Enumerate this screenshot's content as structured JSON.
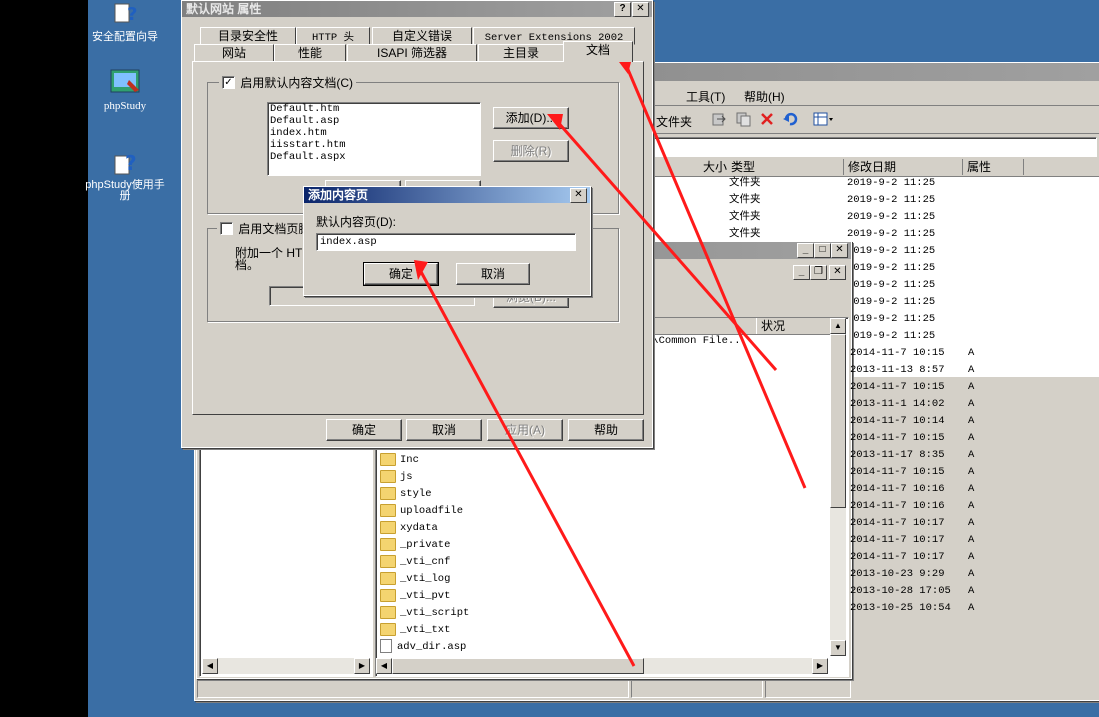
{
  "desktop": {
    "icons": [
      {
        "label": "安全配置向导",
        "icon": "security-wizard-icon"
      },
      {
        "label": "phpStudy",
        "icon": "phpstudy-icon"
      },
      {
        "label": "phpStudy使用手册",
        "icon": "help-manual-icon"
      }
    ]
  },
  "explorer": {
    "menu": {
      "tools": "工具(T)",
      "help": "帮助(H)"
    },
    "toolbar": {
      "folders": "文件夹"
    },
    "columns": {
      "size": "大小",
      "type": "类型",
      "modified": "修改日期",
      "attributes": "属性"
    },
    "top_rows": [
      {
        "type": "文件夹",
        "date": "2019-9-2 11:25"
      },
      {
        "type": "文件夹",
        "date": "2019-9-2 11:25"
      },
      {
        "type": "文件夹",
        "date": "2019-9-2 11:25"
      },
      {
        "type": "文件夹",
        "date": "2019-9-2 11:25"
      }
    ],
    "date_rows_partial": [
      "2019-9-2 11:25",
      "2019-9-2 11:25",
      "2019-9-2 11:25",
      "2019-9-2 11:25",
      "2019-9-2 11:25",
      "2019-9-2 11:25"
    ]
  },
  "inner_window": {
    "status_col": "状况",
    "path_fragment": "s\\Common File...",
    "files": [
      {
        "name": "Inc",
        "kind": "folder"
      },
      {
        "name": "js",
        "kind": "folder"
      },
      {
        "name": "style",
        "kind": "folder"
      },
      {
        "name": "uploadfile",
        "kind": "folder"
      },
      {
        "name": "xydata",
        "kind": "folder"
      },
      {
        "name": "_private",
        "kind": "folder"
      },
      {
        "name": "_vti_cnf",
        "kind": "folder"
      },
      {
        "name": "_vti_log",
        "kind": "folder"
      },
      {
        "name": "_vti_pvt",
        "kind": "folder"
      },
      {
        "name": "_vti_script",
        "kind": "folder"
      },
      {
        "name": "_vti_txt",
        "kind": "folder"
      },
      {
        "name": "adv_dir.asp",
        "kind": "file"
      }
    ],
    "date_rows": [
      {
        "date": "2014-11-7 10:15",
        "attr": "A"
      },
      {
        "date": "2013-11-13 8:57",
        "attr": "A"
      },
      {
        "date": "2014-11-7 10:15",
        "attr": "A"
      },
      {
        "date": "2013-11-1 14:02",
        "attr": "A"
      },
      {
        "date": "2014-11-7 10:14",
        "attr": "A"
      },
      {
        "date": "2014-11-7 10:15",
        "attr": "A"
      },
      {
        "date": "2013-11-17 8:35",
        "attr": "A"
      },
      {
        "date": "2014-11-7 10:15",
        "attr": "A"
      },
      {
        "date": "2014-11-7 10:16",
        "attr": "A"
      },
      {
        "date": "2014-11-7 10:16",
        "attr": "A"
      },
      {
        "date": "2014-11-7 10:17",
        "attr": "A"
      },
      {
        "date": "2014-11-7 10:17",
        "attr": "A"
      },
      {
        "date": "2014-11-7 10:17",
        "attr": "A"
      },
      {
        "date": "2013-10-23 9:29",
        "attr": "A"
      },
      {
        "date": "2013-10-28 17:05",
        "attr": "A"
      },
      {
        "date": "2013-10-25 10:54",
        "attr": "A"
      }
    ]
  },
  "props_dialog": {
    "title": "默认网站 属性",
    "help_glyph": "?",
    "close_glyph": "✕",
    "tabs_row1": [
      "目录安全性",
      "HTTP 头",
      "自定义错误",
      "Server Extensions 2002"
    ],
    "tabs_row2": [
      "网站",
      "性能",
      "ISAPI 筛选器",
      "主目录",
      "文档"
    ],
    "enable_default_doc": "启用默认内容文档(C)",
    "default_docs": [
      "Default.htm",
      "Default.asp",
      "index.htm",
      "iisstart.htm",
      "Default.aspx"
    ],
    "add_button": "添加(D)...",
    "remove_button": "删除(R)",
    "enable_footer": "启用文档页脚",
    "footer_desc_line1": "附加一个 HTM",
    "footer_desc_line2": "档。",
    "browse_button": "浏览(B)...",
    "ok": "确定",
    "cancel": "取消",
    "apply": "应用(A)",
    "help": "帮助"
  },
  "add_dialog": {
    "title": "添加内容页",
    "close_glyph": "✕",
    "label": "默认内容页(D):",
    "value": "index.asp",
    "ok": "确定",
    "cancel": "取消"
  },
  "annotation": {
    "arrow_color": "#ff1a1a"
  }
}
